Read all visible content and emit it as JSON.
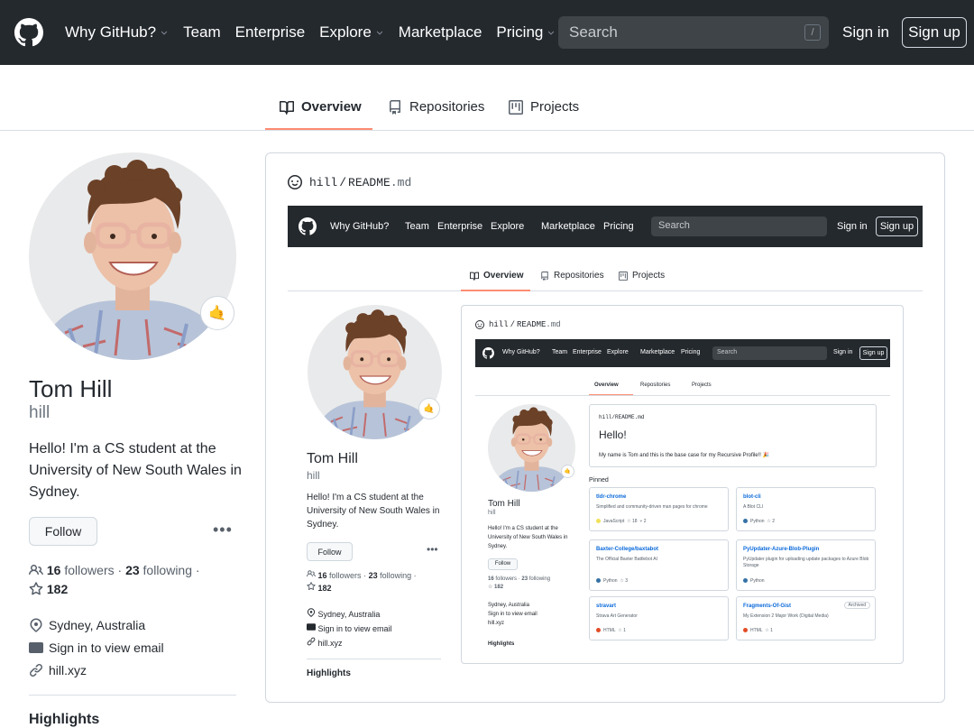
{
  "header": {
    "nav": [
      {
        "label": "Why GitHub?",
        "has_menu": true
      },
      {
        "label": "Team",
        "has_menu": false
      },
      {
        "label": "Enterprise",
        "has_menu": false
      },
      {
        "label": "Explore",
        "has_menu": true
      },
      {
        "label": "Marketplace",
        "has_menu": false
      },
      {
        "label": "Pricing",
        "has_menu": true
      }
    ],
    "search_placeholder": "Search",
    "search_hotkey": "/",
    "sign_in": "Sign in",
    "sign_up": "Sign up"
  },
  "tabs": [
    {
      "label": "Overview",
      "icon": "book-icon",
      "active": true
    },
    {
      "label": "Repositories",
      "icon": "repo-icon",
      "active": false
    },
    {
      "label": "Projects",
      "icon": "project-icon",
      "active": false
    }
  ],
  "profile": {
    "name": "Tom Hill",
    "login": "hill",
    "status_emoji": "🤙",
    "bio": "Hello! I'm a CS student at the University of New South Wales in Sydney.",
    "follow_label": "Follow",
    "followers": "16",
    "followers_label": "followers",
    "following": "23",
    "following_label": "following",
    "stars": "182",
    "location": "Sydney, Australia",
    "email": "Sign in to view email",
    "website": "hill.xyz",
    "highlights_heading": "Highlights"
  },
  "readme": {
    "user": "hill",
    "separator": "/",
    "file": "README",
    "ext": ".md",
    "heading": "Hello!",
    "text": "My name is Tom and this is the base case for my Recursive Profile!! 🎉"
  },
  "pinned": {
    "heading": "Pinned",
    "items": [
      {
        "name": "tldr-chrome",
        "desc": "Simplified and community-driven man pages for chrome",
        "lang": "JavaScript",
        "lang_color": "#f1e05a",
        "stars": "18",
        "forks": "2",
        "archived": ""
      },
      {
        "name": "blot-cli",
        "desc": "A Blot CLI",
        "lang": "Python",
        "lang_color": "#3572A5",
        "stars": "2",
        "forks": "",
        "archived": ""
      },
      {
        "name": "Baxter-College/baxtabot",
        "desc": "The Official Baxter Battlebot AI",
        "lang": "Python",
        "lang_color": "#3572A5",
        "stars": "3",
        "forks": "",
        "archived": ""
      },
      {
        "name": "PyUpdater-Azure-Blob-Plugin",
        "desc": "PyUpdater plugin for uploading update packages to Azure Blob Storage",
        "lang": "Python",
        "lang_color": "#3572A5",
        "stars": "",
        "forks": "",
        "archived": ""
      },
      {
        "name": "stravart",
        "desc": "Strava Art Generator",
        "lang": "HTML",
        "lang_color": "#e34c26",
        "stars": "1",
        "forks": "",
        "archived": ""
      },
      {
        "name": "Fragments-Of-Gist",
        "desc": "My Extension 2 Major Work (Digital Media)",
        "lang": "HTML",
        "lang_color": "#e34c26",
        "stars": "1",
        "forks": "",
        "archived": "Archived"
      }
    ]
  },
  "colors": {
    "header_bg": "#24292e",
    "tab_accent": "#fd8c73",
    "link": "#0969da"
  }
}
